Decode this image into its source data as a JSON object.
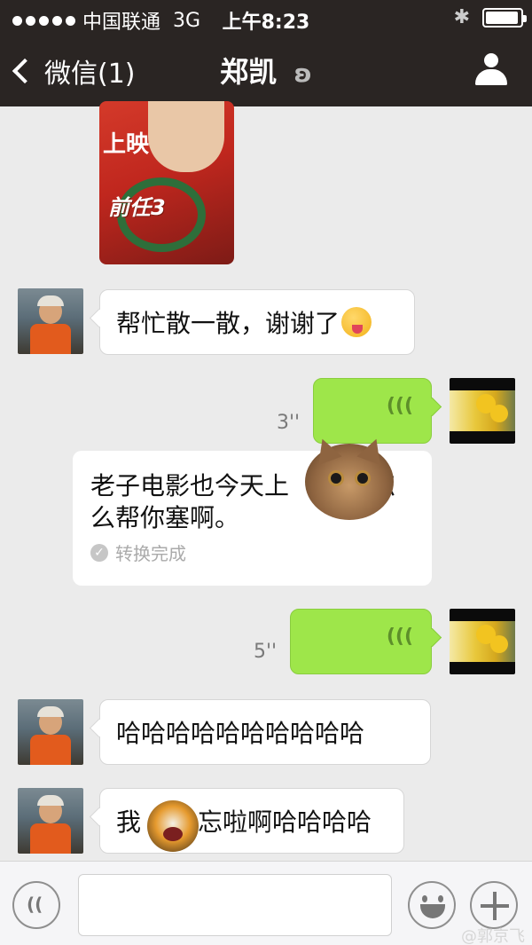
{
  "status_bar": {
    "carrier": "中国联通",
    "network": "3G",
    "time": "上午8:23",
    "battery_level": 0.95
  },
  "nav": {
    "back_label": "微信(1)",
    "title": "郑凯",
    "icons": [
      "ear-icon",
      "person-icon"
    ]
  },
  "messages": [
    {
      "side": "left",
      "type": "text",
      "text": "帮忙散一散，谢谢了",
      "emoji": "tongue-out-emoji"
    },
    {
      "side": "right",
      "type": "voice",
      "duration": "3''"
    },
    {
      "side": "card",
      "type": "transcription",
      "text_line1": "老子电影也今天上",
      "text_line1_end": "怎",
      "text_line2": "么帮你塞啊。",
      "status": "转换完成"
    },
    {
      "side": "right",
      "type": "voice",
      "duration": "5''"
    },
    {
      "side": "left",
      "type": "text",
      "text": "哈哈哈哈哈哈哈哈哈哈"
    },
    {
      "side": "left",
      "type": "text",
      "text_before": "我",
      "text_after": "忘啦啊哈哈哈哈"
    }
  ],
  "poster": {
    "text_top": "上映",
    "text_logo": "前任3"
  },
  "input": {
    "placeholder": ""
  },
  "watermark": "@郭京飞"
}
